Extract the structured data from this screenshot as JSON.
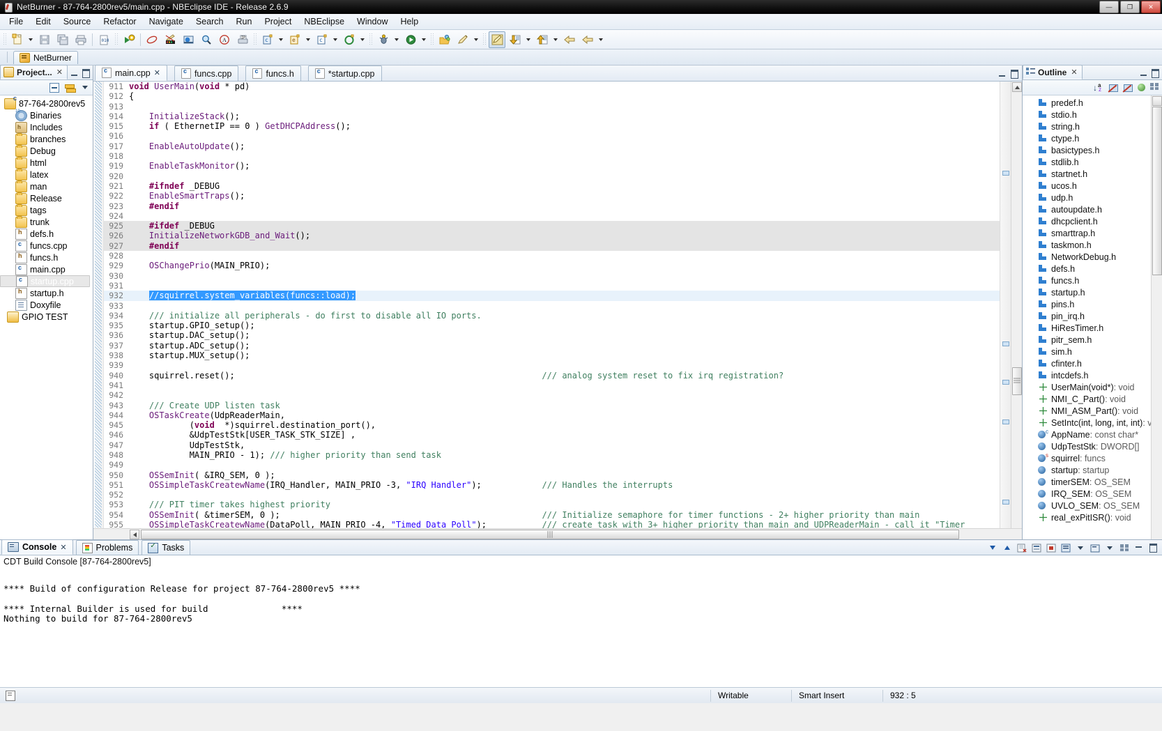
{
  "window": {
    "title": "NetBurner - 87-764-2800rev5/main.cpp - NBEclipse IDE - Release 2.6.9",
    "minimize": "—",
    "maximize": "❐",
    "close": "✕"
  },
  "menubar": {
    "items": [
      "File",
      "Edit",
      "Source",
      "Refactor",
      "Navigate",
      "Search",
      "Run",
      "Project",
      "NBEclipse",
      "Window",
      "Help"
    ]
  },
  "toolbar": {
    "icons": [
      "new-file-icon",
      "save-icon",
      "save-all-icon",
      "print-icon",
      "build-binary-icon",
      "run-external-tools-icon",
      "link-icon",
      "edit-marker-icon",
      "open-declaration-icon",
      "search-icon",
      "annotation-icon",
      "print-ip-icon",
      "new-c-class-icon",
      "new-c-project-icon",
      "new-c-file-icon",
      "new-element-icon",
      "debug-icon",
      "run-icon",
      "open-resource-icon",
      "pencil-icon",
      "highlight-icon",
      "download-icon",
      "upload-icon",
      "back-icon",
      "forward-icon"
    ]
  },
  "perspective": {
    "active_label": "NetBurner"
  },
  "project_explorer": {
    "tab_label": "Project...",
    "tab_close": "✕",
    "toolbar": [
      "collapse-all-icon",
      "link-with-editor-icon",
      "view-menu-icon"
    ],
    "tree": [
      {
        "label": "87-764-2800rev5",
        "icon": "c-project-icon",
        "indent": 0,
        "selected": false
      },
      {
        "label": "Binaries",
        "icon": "binaries-icon",
        "indent": 1,
        "selected": false
      },
      {
        "label": "Includes",
        "icon": "includes-icon",
        "indent": 1,
        "selected": false
      },
      {
        "label": "branches",
        "icon": "folder-icon",
        "indent": 1,
        "selected": false
      },
      {
        "label": "Debug",
        "icon": "folder-icon",
        "indent": 1,
        "selected": false
      },
      {
        "label": "html",
        "icon": "folder-icon",
        "indent": 1,
        "selected": false
      },
      {
        "label": "latex",
        "icon": "folder-icon",
        "indent": 1,
        "selected": false
      },
      {
        "label": "man",
        "icon": "folder-icon",
        "indent": 1,
        "selected": false
      },
      {
        "label": "Release",
        "icon": "folder-icon",
        "indent": 1,
        "selected": false
      },
      {
        "label": "tags",
        "icon": "folder-icon",
        "indent": 1,
        "selected": false
      },
      {
        "label": "trunk",
        "icon": "folder-icon",
        "indent": 1,
        "selected": false
      },
      {
        "label": "defs.h",
        "icon": "h-file-icon",
        "indent": 1,
        "selected": false
      },
      {
        "label": "funcs.cpp",
        "icon": "c-file-icon",
        "indent": 1,
        "selected": false
      },
      {
        "label": "funcs.h",
        "icon": "h-file-icon",
        "indent": 1,
        "selected": false
      },
      {
        "label": "main.cpp",
        "icon": "c-file-icon",
        "indent": 1,
        "selected": false
      },
      {
        "label": "startup.cpp",
        "icon": "c-file-icon",
        "indent": 1,
        "selected": true
      },
      {
        "label": "startup.h",
        "icon": "h-file-icon",
        "indent": 1,
        "selected": false
      },
      {
        "label": "Doxyfile",
        "icon": "document-icon",
        "indent": 1,
        "selected": false
      },
      {
        "label": "GPIO TEST",
        "icon": "project-icon",
        "indent": 0,
        "selected": false
      }
    ]
  },
  "editor": {
    "tabs": [
      {
        "label": "main.cpp",
        "active": true,
        "dirty": false,
        "close": "✕"
      },
      {
        "label": "funcs.cpp",
        "active": false,
        "dirty": false
      },
      {
        "label": "funcs.h",
        "active": false,
        "dirty": false
      },
      {
        "label": "*startup.cpp",
        "active": false,
        "dirty": true
      }
    ],
    "first_line": 911,
    "lines": [
      {
        "n": 911,
        "tokens": [
          {
            "t": "void ",
            "c": "kw"
          },
          {
            "t": "UserMain",
            "c": "fn"
          },
          {
            "t": "(",
            "c": "pl"
          },
          {
            "t": "void",
            "c": "kw"
          },
          {
            "t": " * pd)",
            "c": "pl"
          }
        ]
      },
      {
        "n": 912,
        "tokens": [
          {
            "t": "{",
            "c": "pl"
          }
        ]
      },
      {
        "n": 913,
        "tokens": []
      },
      {
        "n": 914,
        "tokens": [
          {
            "t": "    ",
            "c": "pl"
          },
          {
            "t": "InitializeStack",
            "c": "fn"
          },
          {
            "t": "();",
            "c": "pl"
          }
        ]
      },
      {
        "n": 915,
        "tokens": [
          {
            "t": "    ",
            "c": "pl"
          },
          {
            "t": "if",
            "c": "kw"
          },
          {
            "t": " ( EthernetIP == ",
            "c": "pl"
          },
          {
            "t": "0",
            "c": "num"
          },
          {
            "t": " ) ",
            "c": "pl"
          },
          {
            "t": "GetDHCPAddress",
            "c": "fn"
          },
          {
            "t": "();",
            "c": "pl"
          }
        ]
      },
      {
        "n": 916,
        "tokens": []
      },
      {
        "n": 917,
        "tokens": [
          {
            "t": "    ",
            "c": "pl"
          },
          {
            "t": "EnableAutoUpdate",
            "c": "fn"
          },
          {
            "t": "();",
            "c": "pl"
          }
        ]
      },
      {
        "n": 918,
        "tokens": []
      },
      {
        "n": 919,
        "tokens": [
          {
            "t": "    ",
            "c": "pl"
          },
          {
            "t": "EnableTaskMonitor",
            "c": "fn"
          },
          {
            "t": "();",
            "c": "pl"
          }
        ]
      },
      {
        "n": 920,
        "tokens": []
      },
      {
        "n": 921,
        "tokens": [
          {
            "t": "    ",
            "c": "pl"
          },
          {
            "t": "#ifndef",
            "c": "pp"
          },
          {
            "t": " _DEBUG",
            "c": "pl"
          }
        ]
      },
      {
        "n": 922,
        "tokens": [
          {
            "t": "    ",
            "c": "pl"
          },
          {
            "t": "EnableSmartTraps",
            "c": "fn"
          },
          {
            "t": "();",
            "c": "pl"
          }
        ]
      },
      {
        "n": 923,
        "tokens": [
          {
            "t": "    ",
            "c": "pl"
          },
          {
            "t": "#endif",
            "c": "pp"
          }
        ]
      },
      {
        "n": 924,
        "tokens": []
      },
      {
        "n": 925,
        "block": true,
        "tokens": [
          {
            "t": "    ",
            "c": "pl"
          },
          {
            "t": "#ifdef",
            "c": "pp"
          },
          {
            "t": " _DEBUG",
            "c": "pl"
          }
        ]
      },
      {
        "n": 926,
        "block": true,
        "tokens": [
          {
            "t": "    ",
            "c": "pl"
          },
          {
            "t": "InitializeNetworkGDB_and_Wait",
            "c": "fn"
          },
          {
            "t": "();",
            "c": "pl"
          }
        ]
      },
      {
        "n": 927,
        "block": true,
        "tokens": [
          {
            "t": "    ",
            "c": "pl"
          },
          {
            "t": "#endif",
            "c": "pp"
          }
        ]
      },
      {
        "n": 928,
        "tokens": []
      },
      {
        "n": 929,
        "tokens": [
          {
            "t": "    ",
            "c": "pl"
          },
          {
            "t": "OSChangePrio",
            "c": "fn"
          },
          {
            "t": "(MAIN_PRIO);",
            "c": "pl"
          }
        ]
      },
      {
        "n": 930,
        "tokens": []
      },
      {
        "n": 931,
        "tokens": []
      },
      {
        "n": 932,
        "cursorline": true,
        "tokens": [
          {
            "t": "    ",
            "c": "pl"
          },
          {
            "t": "//squirrel.system_variables(funcs::load);",
            "c": "sel"
          }
        ]
      },
      {
        "n": 933,
        "tokens": []
      },
      {
        "n": 934,
        "tokens": [
          {
            "t": "    ",
            "c": "pl"
          },
          {
            "t": "/// initialize all peripherals - do first to disable all IO ports.",
            "c": "cmt"
          }
        ]
      },
      {
        "n": 935,
        "tokens": [
          {
            "t": "    startup.GPIO_setup();",
            "c": "pl"
          }
        ]
      },
      {
        "n": 936,
        "tokens": [
          {
            "t": "    startup.DAC_setup();",
            "c": "pl"
          }
        ]
      },
      {
        "n": 937,
        "tokens": [
          {
            "t": "    startup.ADC_setup();",
            "c": "pl"
          }
        ]
      },
      {
        "n": 938,
        "tokens": [
          {
            "t": "    startup.MUX_setup();",
            "c": "pl"
          }
        ]
      },
      {
        "n": 939,
        "tokens": []
      },
      {
        "n": 940,
        "tokens": [
          {
            "t": "    squirrel.reset();",
            "c": "pl"
          }
        ],
        "right_comment": "/// analog system reset to fix irq registration?"
      },
      {
        "n": 941,
        "tokens": []
      },
      {
        "n": 942,
        "tokens": []
      },
      {
        "n": 943,
        "tokens": [
          {
            "t": "    ",
            "c": "pl"
          },
          {
            "t": "/// Create UDP listen task",
            "c": "cmt"
          }
        ]
      },
      {
        "n": 944,
        "tokens": [
          {
            "t": "    ",
            "c": "pl"
          },
          {
            "t": "OSTaskCreate",
            "c": "fn"
          },
          {
            "t": "(UdpReaderMain,",
            "c": "pl"
          }
        ]
      },
      {
        "n": 945,
        "tokens": [
          {
            "t": "            (",
            "c": "pl"
          },
          {
            "t": "void",
            "c": "kw"
          },
          {
            "t": "  *)squirrel.destination_port(),",
            "c": "pl"
          }
        ]
      },
      {
        "n": 946,
        "tokens": [
          {
            "t": "            &UdpTestStk[USER_TASK_STK_SIZE] ,",
            "c": "pl"
          }
        ]
      },
      {
        "n": 947,
        "tokens": [
          {
            "t": "            UdpTestStk,",
            "c": "pl"
          }
        ]
      },
      {
        "n": 948,
        "tokens": [
          {
            "t": "            MAIN_PRIO - ",
            "c": "pl"
          },
          {
            "t": "1",
            "c": "num"
          },
          {
            "t": "); ",
            "c": "pl"
          },
          {
            "t": "/// higher priority than send task",
            "c": "cmt"
          }
        ]
      },
      {
        "n": 949,
        "tokens": []
      },
      {
        "n": 950,
        "tokens": [
          {
            "t": "    ",
            "c": "pl"
          },
          {
            "t": "OSSemInit",
            "c": "fn"
          },
          {
            "t": "( &IRQ_SEM, ",
            "c": "pl"
          },
          {
            "t": "0",
            "c": "num"
          },
          {
            "t": " );",
            "c": "pl"
          }
        ]
      },
      {
        "n": 951,
        "tokens": [
          {
            "t": "    ",
            "c": "pl"
          },
          {
            "t": "OSSimpleTaskCreatewName",
            "c": "fn"
          },
          {
            "t": "(IRQ_Handler, MAIN_PRIO -",
            "c": "pl"
          },
          {
            "t": "3",
            "c": "num"
          },
          {
            "t": ", ",
            "c": "pl"
          },
          {
            "t": "\"IRQ Handler\"",
            "c": "str"
          },
          {
            "t": ");",
            "c": "pl"
          }
        ],
        "right_comment": "/// Handles the interrupts"
      },
      {
        "n": 952,
        "tokens": []
      },
      {
        "n": 953,
        "tokens": [
          {
            "t": "    ",
            "c": "pl"
          },
          {
            "t": "/// PIT timer takes highest priority",
            "c": "cmt"
          }
        ]
      },
      {
        "n": 954,
        "tokens": [
          {
            "t": "    ",
            "c": "pl"
          },
          {
            "t": "OSSemInit",
            "c": "fn"
          },
          {
            "t": "( &timerSEM, ",
            "c": "pl"
          },
          {
            "t": "0",
            "c": "num"
          },
          {
            "t": " );",
            "c": "pl"
          }
        ],
        "right_comment": "/// Initialize semaphore for timer functions - 2+ higher priority than main"
      },
      {
        "n": 955,
        "tokens": [
          {
            "t": "    ",
            "c": "pl"
          },
          {
            "t": "OSSimpleTaskCreatewName",
            "c": "fn"
          },
          {
            "t": "(DataPoll, MAIN_PRIO -",
            "c": "pl"
          },
          {
            "t": "4",
            "c": "num"
          },
          {
            "t": ", ",
            "c": "pl"
          },
          {
            "t": "\"Timed Data Poll\"",
            "c": "str"
          },
          {
            "t": ");",
            "c": "pl"
          }
        ],
        "right_comment": "/// create task with 3+ higher priority than main and UDPReaderMain - call it \"Timer"
      }
    ]
  },
  "outline": {
    "tab_label": "Outline",
    "tab_close": "✕",
    "toolbar": [
      "sort-icon",
      "hide-fields-icon",
      "hide-static-icon",
      "hide-nonpublic-icon",
      "view-menu-icon"
    ],
    "items": [
      {
        "name": "predef.h",
        "kind": "include"
      },
      {
        "name": "stdio.h",
        "kind": "include"
      },
      {
        "name": "string.h",
        "kind": "include"
      },
      {
        "name": "ctype.h",
        "kind": "include"
      },
      {
        "name": "basictypes.h",
        "kind": "include"
      },
      {
        "name": "stdlib.h",
        "kind": "include"
      },
      {
        "name": "startnet.h",
        "kind": "include"
      },
      {
        "name": "ucos.h",
        "kind": "include"
      },
      {
        "name": "udp.h",
        "kind": "include"
      },
      {
        "name": "autoupdate.h",
        "kind": "include"
      },
      {
        "name": "dhcpclient.h",
        "kind": "include"
      },
      {
        "name": "smarttrap.h",
        "kind": "include"
      },
      {
        "name": "taskmon.h",
        "kind": "include"
      },
      {
        "name": "NetworkDebug.h",
        "kind": "include"
      },
      {
        "name": "defs.h",
        "kind": "include"
      },
      {
        "name": "funcs.h",
        "kind": "include"
      },
      {
        "name": "startup.h",
        "kind": "include"
      },
      {
        "name": "pins.h",
        "kind": "include"
      },
      {
        "name": "pin_irq.h",
        "kind": "include"
      },
      {
        "name": "HiResTimer.h",
        "kind": "include"
      },
      {
        "name": "pitr_sem.h",
        "kind": "include"
      },
      {
        "name": "sim.h",
        "kind": "include"
      },
      {
        "name": "cfinter.h",
        "kind": "include"
      },
      {
        "name": "intcdefs.h",
        "kind": "include"
      },
      {
        "name": "UserMain(void*)",
        "type": " : void",
        "kind": "function"
      },
      {
        "name": "NMI_C_Part()",
        "type": " : void",
        "kind": "function"
      },
      {
        "name": "NMI_ASM_Part()",
        "type": " : void",
        "kind": "function"
      },
      {
        "name": "SetIntc(int, long, int, int)",
        "type": " : v",
        "kind": "function"
      },
      {
        "name": "AppName",
        "type": " : const char*",
        "kind": "variable",
        "badge": "c"
      },
      {
        "name": "UdpTestStk",
        "type": " : DWORD[]",
        "kind": "variable"
      },
      {
        "name": "squirrel",
        "type": " : funcs",
        "kind": "variable",
        "badge": "s"
      },
      {
        "name": "startup",
        "type": " : startup",
        "kind": "variable"
      },
      {
        "name": "timerSEM",
        "type": " : OS_SEM",
        "kind": "variable"
      },
      {
        "name": "IRQ_SEM",
        "type": " : OS_SEM",
        "kind": "variable"
      },
      {
        "name": "UVLO_SEM",
        "type": " : OS_SEM",
        "kind": "variable"
      },
      {
        "name": "real_exPitISR()",
        "type": " : void",
        "kind": "function"
      }
    ]
  },
  "bottom_panel": {
    "tabs": [
      {
        "label": "Console",
        "active": true,
        "icon": "console-icon",
        "close": "✕"
      },
      {
        "label": "Problems",
        "active": false,
        "icon": "problems-icon"
      },
      {
        "label": "Tasks",
        "active": false,
        "icon": "tasks-icon"
      }
    ],
    "console_name": "CDT Build Console [87-764-2800rev5]",
    "log_lines": [
      "",
      "**** Build of configuration Release for project 87-764-2800rev5 ****",
      "",
      "**** Internal Builder is used for build              ****",
      "Nothing to build for 87-764-2800rev5"
    ],
    "toolbar_icons": [
      "scroll-down-icon",
      "scroll-up-icon",
      "clear-console-icon",
      "pin-console-icon",
      "lock-scroll-icon",
      "display-selected-console-icon",
      "open-console-icon",
      "view-menu-icon"
    ]
  },
  "statusbar": {
    "writable": "Writable",
    "insert_mode": "Smart Insert",
    "cursor_position": "932 : 5"
  }
}
